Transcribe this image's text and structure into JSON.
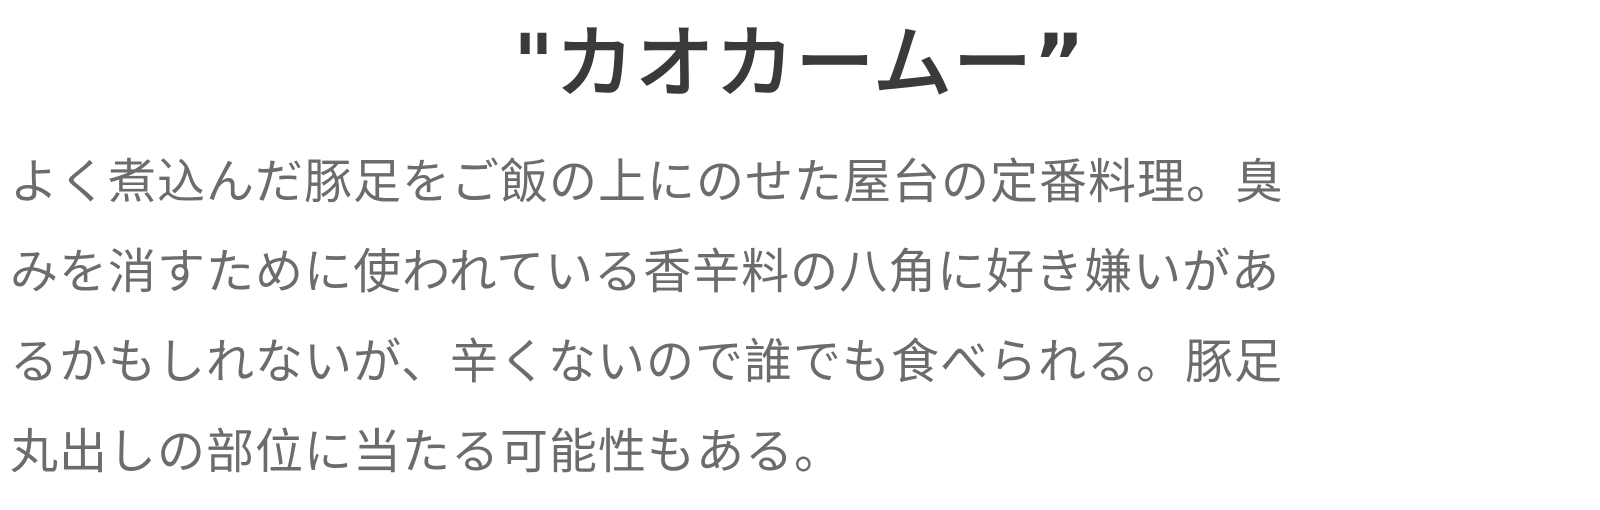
{
  "title": "\"カオカームー”",
  "description": {
    "lines": [
      "よく煮込んだ豚足をご飯の上にのせた屋台の定番料理。臭",
      "みを消すために使われている香辛料の八角に好き嫌いがあ",
      "るかもしれないが、辛くないので誰でも食べられる。豚足",
      "丸出しの部位に当たる可能性もある。"
    ]
  }
}
